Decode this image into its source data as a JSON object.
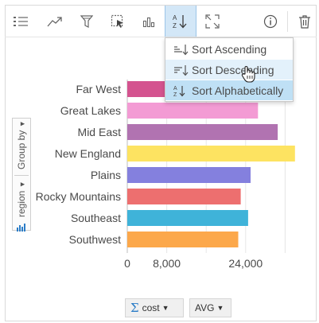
{
  "toolbar": {
    "buttons": [
      {
        "name": "list-icon"
      },
      {
        "name": "trend-icon"
      },
      {
        "name": "filter-icon"
      },
      {
        "name": "select-icon"
      },
      {
        "name": "bar-chart-icon"
      },
      {
        "name": "sort-icon",
        "active": true
      },
      {
        "name": "expand-icon"
      },
      {
        "name": "info-icon"
      },
      {
        "name": "trash-icon"
      }
    ]
  },
  "sort_menu": {
    "items": [
      {
        "label": "Sort Ascending",
        "icon": "sort-ascending-icon"
      },
      {
        "label": "Sort Descending",
        "icon": "sort-descending-icon",
        "state": "hover"
      },
      {
        "label": "Sort Alphabetically",
        "icon": "sort-alphabetical-icon",
        "state": "selected"
      }
    ]
  },
  "side_panel": {
    "group_by_label": "Group by",
    "field_label": "region"
  },
  "footer": {
    "sum_field": "cost",
    "statistic": "AVG"
  },
  "chart_data": {
    "type": "bar",
    "orientation": "horizontal",
    "categories": [
      "Far West",
      "Great Lakes",
      "Mid East",
      "New England",
      "Plains",
      "Rocky Mountains",
      "Southeast",
      "Southwest"
    ],
    "values": [
      26000,
      26500,
      30500,
      34000,
      25000,
      23000,
      24500,
      22500
    ],
    "colors": [
      "#d4538f",
      "#f39bd4",
      "#b173b1",
      "#fde361",
      "#8480de",
      "#ed6f6f",
      "#3fb3d9",
      "#fca84b"
    ],
    "xlim": [
      0,
      35000
    ],
    "xticks": [
      0,
      8000,
      24000
    ],
    "xtick_labels": [
      "0",
      "8,000",
      "24,000"
    ],
    "grid": true
  }
}
